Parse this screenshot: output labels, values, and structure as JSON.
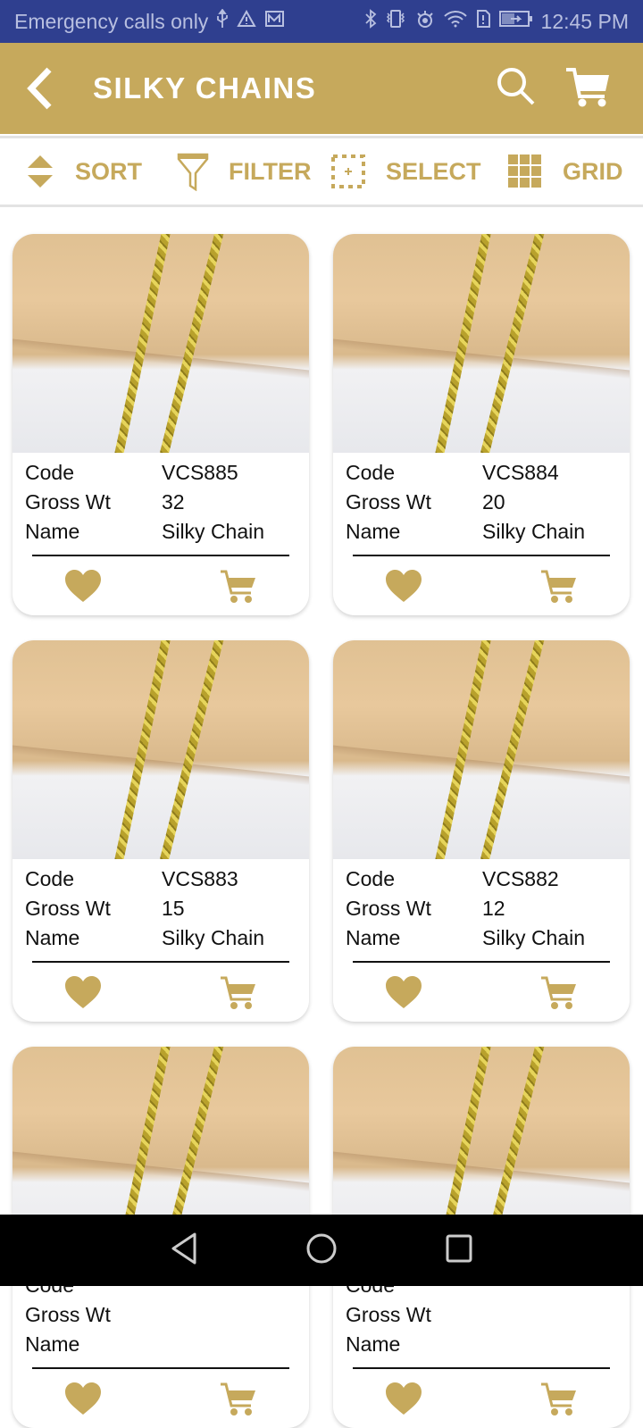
{
  "status_bar": {
    "carrier_text": "Emergency calls only",
    "time": "12:45 PM",
    "left_icons": [
      "usb-icon",
      "warning-icon",
      "mail-icon"
    ],
    "right_icons": [
      "bluetooth-icon",
      "vibrate-icon",
      "eye-icon",
      "wifi-icon",
      "sim-alert-icon",
      "battery-charging-icon"
    ]
  },
  "app_bar": {
    "title": "SILKY CHAINS",
    "back_icon": "chevron-left-icon",
    "search_icon": "search-icon",
    "cart_icon": "cart-icon"
  },
  "toolbar": {
    "sort_label": "SORT",
    "filter_label": "FILTER",
    "select_label": "SELECT",
    "grid_label": "GRID"
  },
  "colors": {
    "accent": "#c6a95c",
    "status_bar": "#2f3f8f",
    "nav_bar": "#000000"
  },
  "field_labels": {
    "code": "Code",
    "gross_wt": "Gross Wt",
    "name": "Name"
  },
  "products": [
    {
      "code": "VCS885",
      "gross_wt": "32",
      "name": "Silky Chain"
    },
    {
      "code": "VCS884",
      "gross_wt": "20",
      "name": "Silky Chain"
    },
    {
      "code": "VCS883",
      "gross_wt": "15",
      "name": "Silky Chain"
    },
    {
      "code": "VCS882",
      "gross_wt": "12",
      "name": "Silky Chain"
    },
    {
      "code": "",
      "gross_wt": "",
      "name": ""
    },
    {
      "code": "",
      "gross_wt": "",
      "name": ""
    }
  ],
  "nav_bar": {
    "back": "back-triangle-icon",
    "home": "home-circle-icon",
    "recents": "recents-square-icon"
  }
}
